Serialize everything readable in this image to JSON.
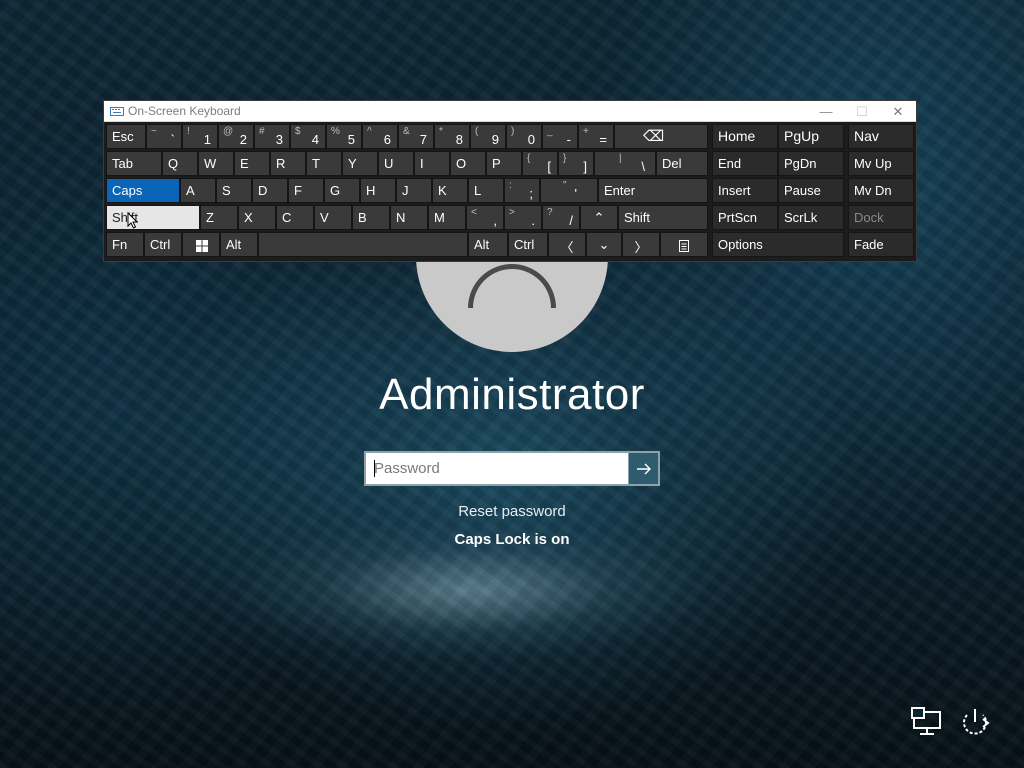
{
  "osk": {
    "title": "On-Screen Keyboard",
    "window_buttons": {
      "minimize": "—",
      "maximize": "☐",
      "close": "✕"
    },
    "row1": {
      "esc": "Esc",
      "digits": [
        {
          "shift": "~",
          "main": "`"
        },
        {
          "shift": "!",
          "main": "1"
        },
        {
          "shift": "@",
          "main": "2"
        },
        {
          "shift": "#",
          "main": "3"
        },
        {
          "shift": "$",
          "main": "4"
        },
        {
          "shift": "%",
          "main": "5"
        },
        {
          "shift": "^",
          "main": "6"
        },
        {
          "shift": "&",
          "main": "7"
        },
        {
          "shift": "*",
          "main": "8"
        },
        {
          "shift": "(",
          "main": "9"
        },
        {
          "shift": ")",
          "main": "0"
        },
        {
          "shift": "_",
          "main": "-"
        },
        {
          "shift": "+",
          "main": "="
        }
      ],
      "backspace": "⌫"
    },
    "row2": {
      "tab": "Tab",
      "letters": [
        "Q",
        "W",
        "E",
        "R",
        "T",
        "Y",
        "U",
        "I",
        "O",
        "P"
      ],
      "lbracket": {
        "shift": "{",
        "main": "["
      },
      "rbracket": {
        "shift": "}",
        "main": "]"
      },
      "backslash": {
        "shift": "|",
        "main": "\\"
      },
      "del": "Del"
    },
    "row3": {
      "caps": "Caps",
      "letters": [
        "A",
        "S",
        "D",
        "F",
        "G",
        "H",
        "J",
        "K",
        "L"
      ],
      "semicolon": {
        "shift": ":",
        "main": ";"
      },
      "quote": {
        "shift": "\"",
        "main": "'"
      },
      "enter": "Enter"
    },
    "row4": {
      "shift_left": "Shift",
      "letters": [
        "Z",
        "X",
        "C",
        "V",
        "B",
        "N",
        "M"
      ],
      "comma": {
        "shift": "<",
        "main": ","
      },
      "period": {
        "shift": ">",
        "main": "."
      },
      "slash": {
        "shift": "?",
        "main": "/"
      },
      "up": "⌃",
      "shift_right": "Shift"
    },
    "row5": {
      "fn": "Fn",
      "ctrl": "Ctrl",
      "alt": "Alt",
      "alt_right": "Alt",
      "ctrl_right": "Ctrl",
      "left": "〈",
      "down": "⌄",
      "right": "〉"
    },
    "nav_keys": {
      "home": "Home",
      "pgup": "PgUp",
      "nav": "Nav",
      "end": "End",
      "pgdn": "PgDn",
      "mvup": "Mv Up",
      "insert": "Insert",
      "pause": "Pause",
      "mvdn": "Mv Dn",
      "prtscn": "PrtScn",
      "scrlk": "ScrLk",
      "dock": "Dock",
      "options": "Options",
      "fade": "Fade"
    },
    "caps_active": true,
    "shift_active": true
  },
  "lock": {
    "username": "Administrator",
    "password_placeholder": "Password",
    "submit_icon": "arrow-right-icon",
    "reset_link": "Reset password",
    "caps_message": "Caps Lock is on"
  },
  "colors": {
    "caps_key": "#0a64b8",
    "key": "#3a3a3a",
    "nav_key": "#2b2b2b",
    "submit": "#2f5b6e"
  },
  "icons": {
    "network": "network-icon",
    "power": "power-icon"
  }
}
